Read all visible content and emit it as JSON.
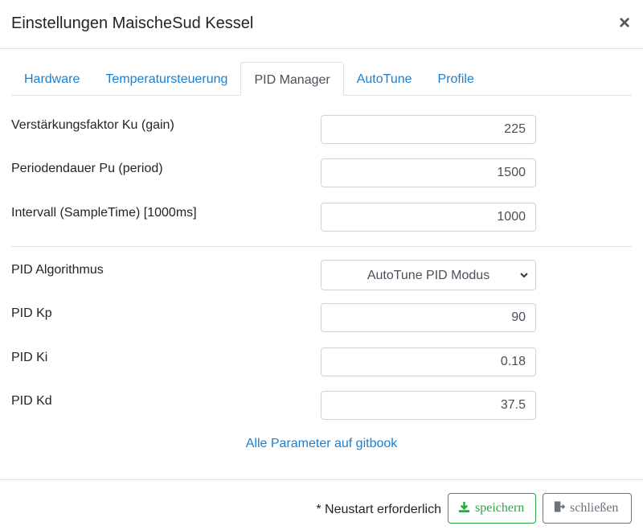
{
  "header": {
    "title": "Einstellungen MaischeSud Kessel",
    "close_symbol": "×"
  },
  "tabs": [
    {
      "label": "Hardware",
      "active": false
    },
    {
      "label": "Temperatursteuerung",
      "active": false
    },
    {
      "label": "PID Manager",
      "active": true
    },
    {
      "label": "AutoTune",
      "active": false
    },
    {
      "label": "Profile",
      "active": false
    }
  ],
  "form": {
    "ku": {
      "label": "Verstärkungsfaktor Ku (gain)",
      "value": "225"
    },
    "pu": {
      "label": "Periodendauer Pu (period)",
      "value": "1500"
    },
    "interval": {
      "label": "Intervall (SampleTime) [1000ms]",
      "value": "1000"
    },
    "algorithm": {
      "label": "PID Algorithmus",
      "selected": "AutoTune PID Modus"
    },
    "kp": {
      "label": "PID Kp",
      "value": "90"
    },
    "ki": {
      "label": "PID Ki",
      "value": "0.18"
    },
    "kd": {
      "label": "PID Kd",
      "value": "37.5"
    }
  },
  "link": {
    "text": "Alle Parameter auf gitbook"
  },
  "footer": {
    "note": "* Neustart erforderlich",
    "save_label": "speichern",
    "close_label": "schließen"
  },
  "colors": {
    "link": "#1a7fd1",
    "save": "#28a745",
    "close": "#6c757d"
  },
  "icons": {
    "save": "download-icon",
    "close": "exit-icon",
    "select": "chevron-down-icon"
  }
}
